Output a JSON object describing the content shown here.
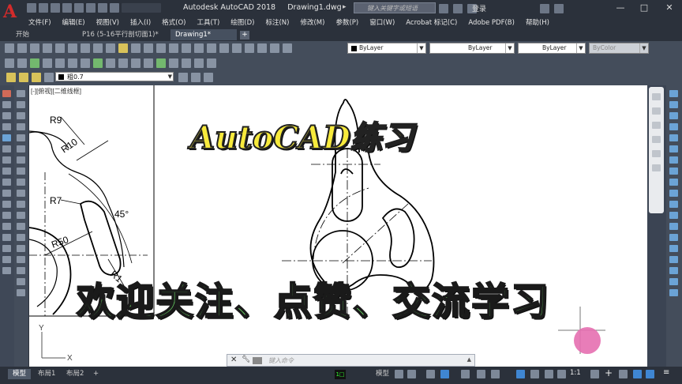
{
  "app": {
    "logo_letter": "A",
    "title": "Autodesk AutoCAD 2018",
    "filename": "Drawing1.dwg",
    "search_placeholder": "键入关键字或短语",
    "signin_label": "登录",
    "window_buttons": [
      "—",
      "□",
      "✕"
    ]
  },
  "menu": {
    "items": [
      "文件(F)",
      "编辑(E)",
      "视图(V)",
      "插入(I)",
      "格式(O)",
      "工具(T)",
      "绘图(D)",
      "标注(N)",
      "修改(M)",
      "参数(P)",
      "窗口(W)",
      "Acrobat 标记(C)",
      "Adobe PDF(B)",
      "帮助(H)"
    ]
  },
  "tabs": {
    "start": "开始",
    "file1": "P16 (5-16平行剖切面1)*",
    "file2": "Drawing1*",
    "new_tab": "+"
  },
  "properties": {
    "color": "ByLayer",
    "linetype": "ByLayer",
    "lineweight": "ByLayer",
    "plotstyle": "ByColor"
  },
  "layer": {
    "current": "粗0.7"
  },
  "viewport_label": "[-][俯视][二维线框]",
  "drawing": {
    "left_dims": {
      "r9": "R9",
      "r10": "R10",
      "r7": "R7",
      "r50": "R50",
      "angle": "45°",
      "r1": "R1"
    },
    "ucs_y": "Y",
    "ucs_x": "X"
  },
  "overlay": {
    "title": "AutoCAD练习",
    "subtitle": "欢迎关注、点赞、交流学习",
    "title_color": "#f7ea3c",
    "subtitle_color": "#6fe56a"
  },
  "command": {
    "placeholder": "键入命令",
    "prompt_icon": "command-prompt-icon"
  },
  "status": {
    "layout_tabs": [
      "模型",
      "布局1",
      "布局2"
    ],
    "add_tab": "+",
    "model_label": "模型",
    "scale": "1:1"
  },
  "colors": {
    "accent": "#3f86d2",
    "cursor_highlight": "#e66fb0",
    "app_red": "#d32b2b"
  }
}
